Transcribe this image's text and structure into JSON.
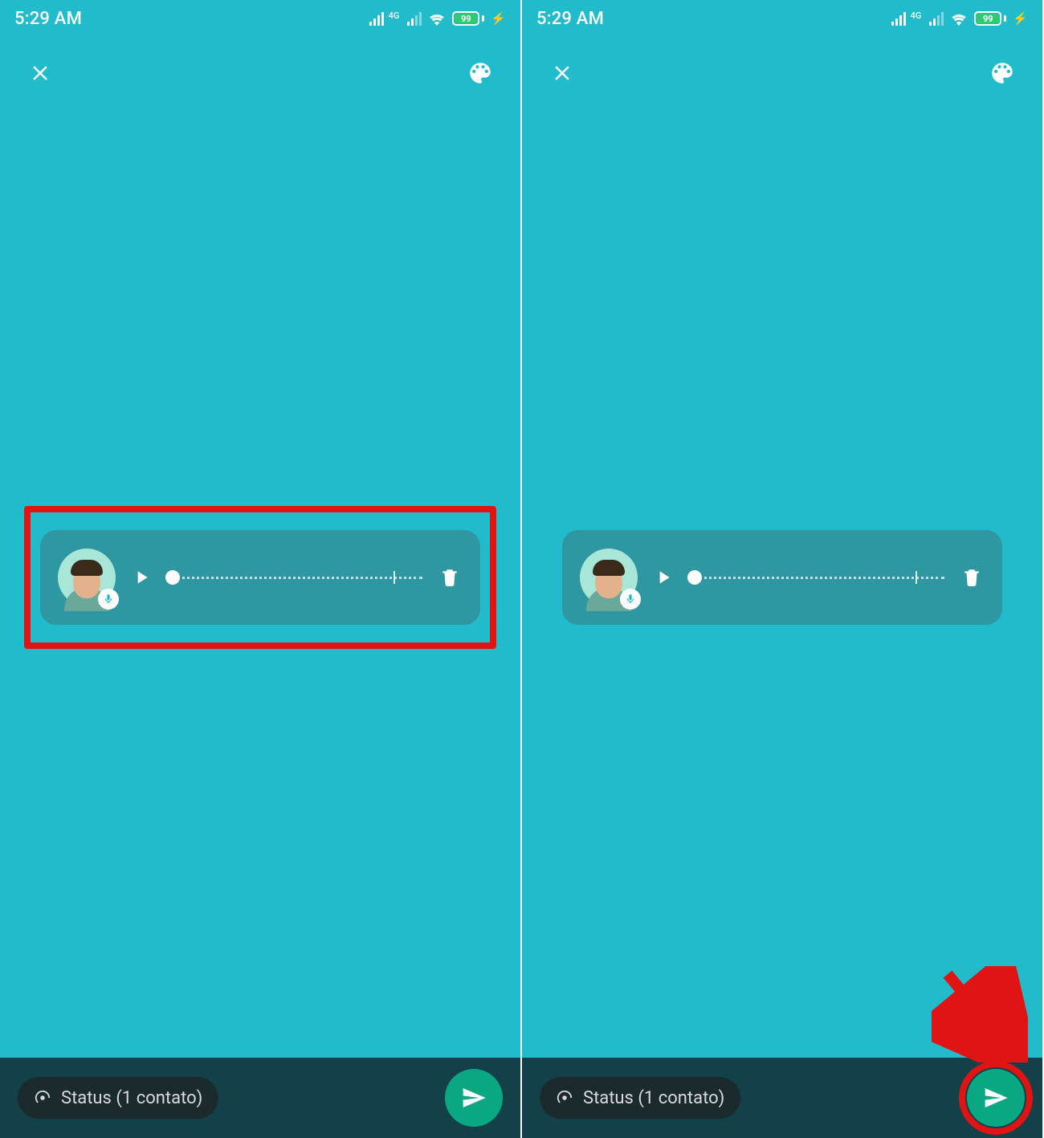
{
  "statusbar": {
    "time": "5:29 AM",
    "network_label": "4G",
    "battery_pct": "99"
  },
  "topbar": {
    "close_name": "close-icon",
    "palette_name": "palette-icon"
  },
  "voice": {
    "play_name": "play-icon",
    "trash_name": "trash-icon",
    "mic_name": "microphone-icon",
    "avatar_name": "avatar"
  },
  "footer": {
    "status_icon_name": "status-ring-icon",
    "status_label": "Status (1 contato)",
    "send_name": "send-icon"
  },
  "annotations": {
    "left_highlight": true,
    "right_circle": true,
    "right_arrow": true
  },
  "colors": {
    "bg": "#21bccb",
    "card": "#2f97a2",
    "bottom": "#13414a",
    "accent": "#0aa783",
    "highlight": "#e11414"
  }
}
